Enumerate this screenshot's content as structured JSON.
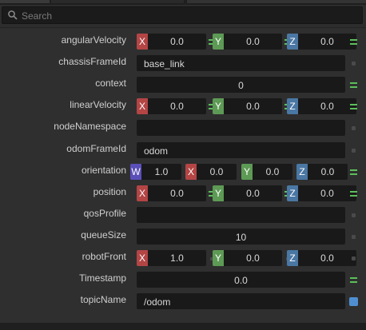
{
  "search": {
    "placeholder": "Search"
  },
  "properties": [
    {
      "label": "angularVelocity",
      "type": "xyz",
      "x": "0.0",
      "y": "0.0",
      "z": "0.0",
      "state": "linked"
    },
    {
      "label": "chassisFrameId",
      "type": "text",
      "value": "base_link",
      "state": "unset"
    },
    {
      "label": "context",
      "type": "number",
      "value": "0",
      "state": "linked"
    },
    {
      "label": "linearVelocity",
      "type": "xyz",
      "x": "0.0",
      "y": "0.0",
      "z": "0.0",
      "state": "linked"
    },
    {
      "label": "nodeNamespace",
      "type": "text",
      "value": "",
      "state": "unset"
    },
    {
      "label": "odomFrameId",
      "type": "text",
      "value": "odom",
      "state": "unset"
    },
    {
      "label": "orientation",
      "type": "wxyz",
      "w": "1.0",
      "x": "0.0",
      "y": "0.0",
      "z": "0.0",
      "state": "linked"
    },
    {
      "label": "position",
      "type": "xyz",
      "x": "0.0",
      "y": "0.0",
      "z": "0.0",
      "state": "linked"
    },
    {
      "label": "qosProfile",
      "type": "text",
      "value": "",
      "state": "unset"
    },
    {
      "label": "queueSize",
      "type": "number",
      "value": "10",
      "state": "unset"
    },
    {
      "label": "robotFront",
      "type": "xyz-unlinked",
      "x": "1.0",
      "y": "0.0",
      "z": "0.0",
      "state": "unset"
    },
    {
      "label": "Timestamp",
      "type": "number",
      "value": "0.0",
      "state": "linked"
    },
    {
      "label": "topicName",
      "type": "text",
      "value": "/odom",
      "state": "modified"
    }
  ],
  "axis_letters": {
    "w": "W",
    "x": "X",
    "y": "Y",
    "z": "Z"
  },
  "colors": {
    "axis_x": "#b44545",
    "axis_y": "#5d9a55",
    "axis_z": "#4a77a3",
    "axis_w": "#5a4fb8",
    "linked": "#5bbf5b",
    "modified": "#4f8fd1"
  }
}
